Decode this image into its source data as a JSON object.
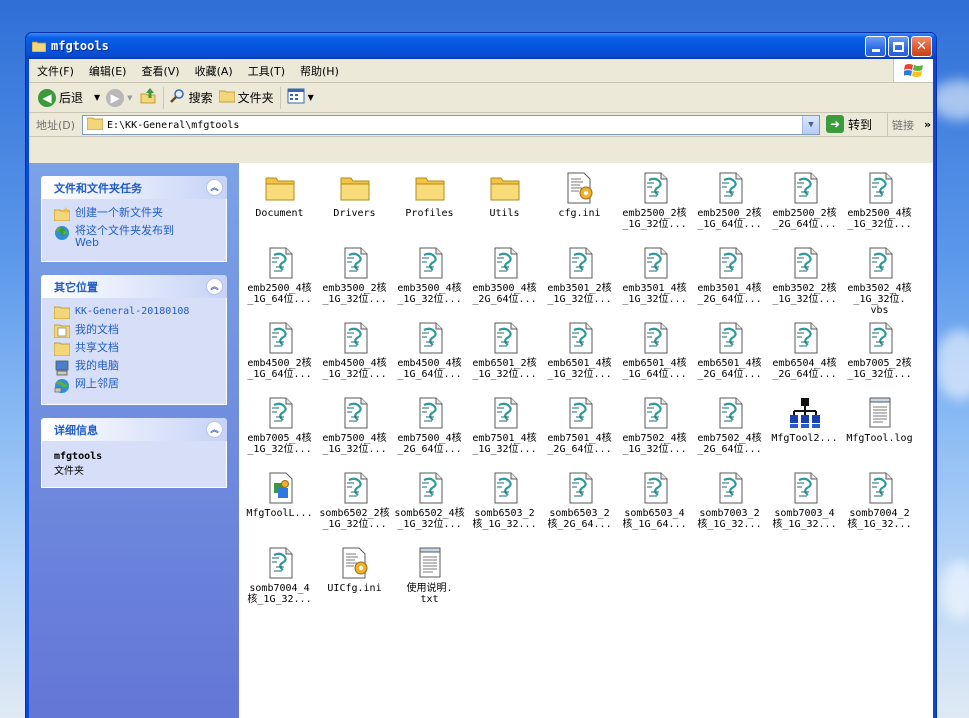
{
  "window": {
    "title": "mfgtools"
  },
  "menu": [
    {
      "label": "文件(F)"
    },
    {
      "label": "编辑(E)"
    },
    {
      "label": "查看(V)"
    },
    {
      "label": "收藏(A)"
    },
    {
      "label": "工具(T)"
    },
    {
      "label": "帮助(H)"
    }
  ],
  "toolbar": {
    "back": "后退",
    "search": "搜索",
    "folders": "文件夹"
  },
  "address": {
    "label": "地址(D)",
    "path": "E:\\KK-General\\mfgtools",
    "go": "转到",
    "links": "链接"
  },
  "tasks": {
    "title": "文件和文件夹任务",
    "items": [
      {
        "label": "创建一个新文件夹",
        "icon": "new-folder-icon"
      },
      {
        "label": "将这个文件夹发布到\nWeb",
        "icon": "publish-web-icon"
      }
    ]
  },
  "places": {
    "title": "其它位置",
    "items": [
      {
        "label": "KK-General-20180108",
        "icon": "folder-icon"
      },
      {
        "label": "我的文档",
        "icon": "my-documents-icon"
      },
      {
        "label": "共享文档",
        "icon": "shared-folder-icon"
      },
      {
        "label": "我的电脑",
        "icon": "my-computer-icon"
      },
      {
        "label": "网上邻居",
        "icon": "network-icon"
      }
    ]
  },
  "details": {
    "title": "详细信息",
    "name": "mfgtools",
    "type": "文件夹"
  },
  "files": [
    {
      "name": "Document",
      "type": "folder"
    },
    {
      "name": "Drivers",
      "type": "folder"
    },
    {
      "name": "Profiles",
      "type": "folder"
    },
    {
      "name": "Utils",
      "type": "folder"
    },
    {
      "name": "cfg.ini",
      "type": "ini"
    },
    {
      "name": "emb2500_2核\n_1G_32位...",
      "type": "script"
    },
    {
      "name": "emb2500_2核\n_1G_64位...",
      "type": "script"
    },
    {
      "name": "emb2500_2核\n_2G_64位...",
      "type": "script"
    },
    {
      "name": "emb2500_4核\n_1G_32位...",
      "type": "script"
    },
    {
      "name": "emb2500_4核\n_1G_64位...",
      "type": "script"
    },
    {
      "name": "emb3500_2核\n_1G_32位...",
      "type": "script"
    },
    {
      "name": "emb3500_4核\n_1G_32位...",
      "type": "script"
    },
    {
      "name": "emb3500_4核\n_2G_64位...",
      "type": "script"
    },
    {
      "name": "emb3501_2核\n_1G_32位...",
      "type": "script"
    },
    {
      "name": "emb3501_4核\n_1G_32位...",
      "type": "script"
    },
    {
      "name": "emb3501_4核\n_2G_64位...",
      "type": "script"
    },
    {
      "name": "emb3502_2核\n_1G_32位...",
      "type": "script"
    },
    {
      "name": "emb3502_4核\n_1G_32位.\nvbs",
      "type": "script"
    },
    {
      "name": "emb4500_2核\n_1G_64位...",
      "type": "script"
    },
    {
      "name": "emb4500_4核\n_1G_32位...",
      "type": "script"
    },
    {
      "name": "emb4500_4核\n_1G_64位...",
      "type": "script"
    },
    {
      "name": "emb6501_2核\n_1G_32位...",
      "type": "script"
    },
    {
      "name": "emb6501_4核\n_1G_32位...",
      "type": "script"
    },
    {
      "name": "emb6501_4核\n_1G_64位...",
      "type": "script"
    },
    {
      "name": "emb6501_4核\n_2G_64位...",
      "type": "script"
    },
    {
      "name": "emb6504_4核\n_2G_64位...",
      "type": "script"
    },
    {
      "name": "emb7005_2核\n_1G_32位...",
      "type": "script"
    },
    {
      "name": "emb7005_4核\n_1G_32位...",
      "type": "script"
    },
    {
      "name": "emb7500_4核\n_1G_32位...",
      "type": "script"
    },
    {
      "name": "emb7500_4核\n_2G_64位...",
      "type": "script"
    },
    {
      "name": "emb7501_4核\n_1G_32位...",
      "type": "script"
    },
    {
      "name": "emb7501_4核\n_2G_64位...",
      "type": "script"
    },
    {
      "name": "emb7502_4核\n_1G_32位...",
      "type": "script"
    },
    {
      "name": "emb7502_4核\n_2G_64位...",
      "type": "script"
    },
    {
      "name": "MfgTool2...",
      "type": "app"
    },
    {
      "name": "MfgTool.log",
      "type": "text"
    },
    {
      "name": "MfgToolL...",
      "type": "dll"
    },
    {
      "name": "somb6502_2核\n_1G_32位...",
      "type": "script"
    },
    {
      "name": "somb6502_4核\n_1G_32位...",
      "type": "script"
    },
    {
      "name": "somb6503_2\n核_1G_32...",
      "type": "script"
    },
    {
      "name": "somb6503_2\n核_2G_64...",
      "type": "script"
    },
    {
      "name": "somb6503_4\n核_1G_64...",
      "type": "script"
    },
    {
      "name": "somb7003_2\n核_1G_32...",
      "type": "script"
    },
    {
      "name": "somb7003_4\n核_1G_32...",
      "type": "script"
    },
    {
      "name": "somb7004_2\n核_1G_32...",
      "type": "script"
    },
    {
      "name": "somb7004_4\n核_1G_32...",
      "type": "script"
    },
    {
      "name": "UICfg.ini",
      "type": "ini"
    },
    {
      "name": "使用说明.\ntxt",
      "type": "text"
    }
  ]
}
